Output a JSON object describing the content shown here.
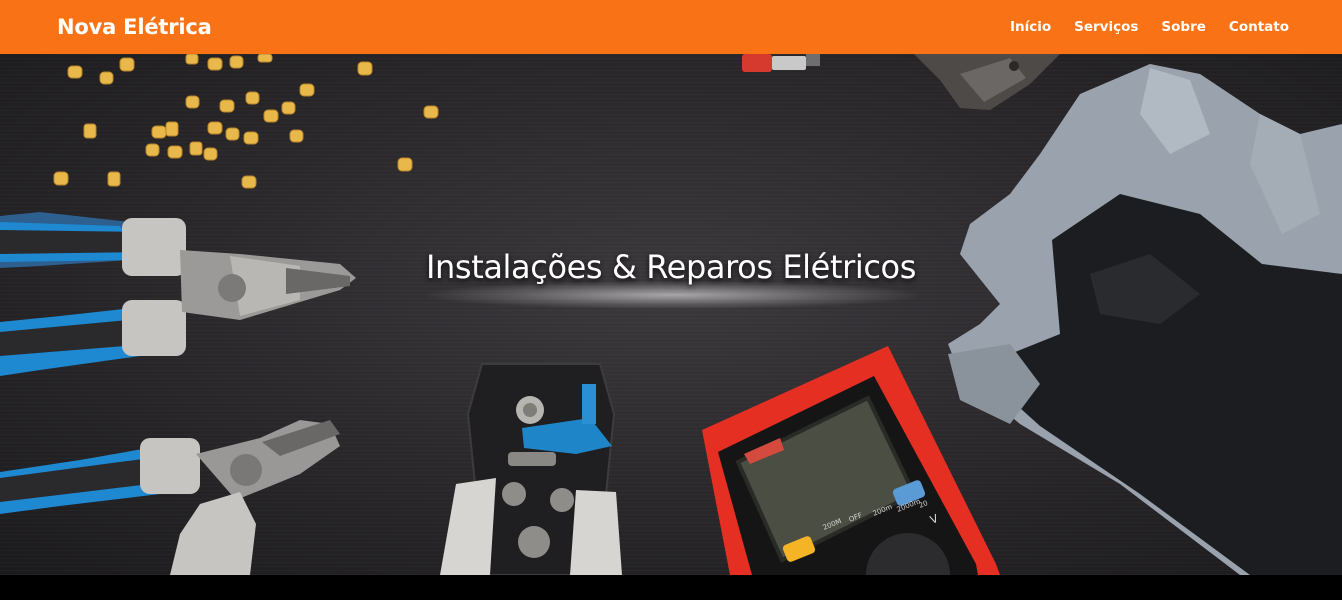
{
  "navbar": {
    "brand": "Nova Elétrica",
    "links": [
      "Início",
      "Serviços",
      "Sobre",
      "Contato"
    ],
    "background_color": "#f97316"
  },
  "hero": {
    "title": "Instalações & Reparos Elétricos",
    "image_subject": "electrician tools on dark wood: pliers, wire markers, wire stripper, multimeter, gloves"
  },
  "multimeter": {
    "dial_labels": [
      "200M",
      "OFF",
      "200m",
      "2000m",
      "20",
      "V"
    ]
  }
}
